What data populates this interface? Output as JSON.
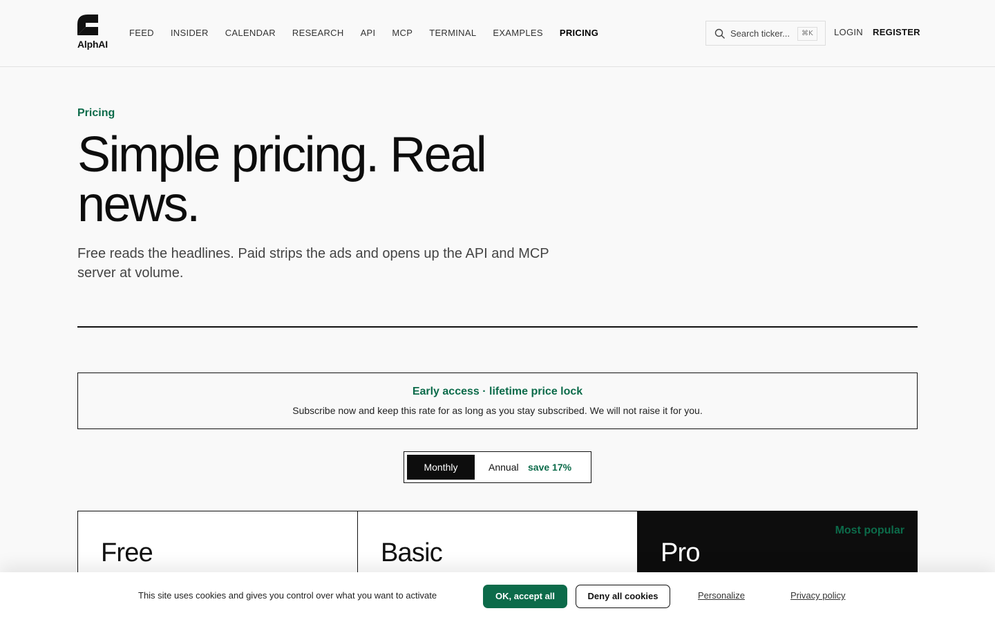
{
  "brand": {
    "name": "AlphAI",
    "logo_icon": "alphai-logo-icon"
  },
  "nav": {
    "items": [
      {
        "label": "FEED"
      },
      {
        "label": "INSIDER"
      },
      {
        "label": "CALENDAR"
      },
      {
        "label": "RESEARCH"
      },
      {
        "label": "API"
      },
      {
        "label": "MCP"
      },
      {
        "label": "TERMINAL"
      },
      {
        "label": "EXAMPLES"
      },
      {
        "label": "PRICING"
      }
    ],
    "active": "PRICING"
  },
  "search": {
    "placeholder": "Search ticker...",
    "shortcut": "⌘K",
    "icon": "search-icon"
  },
  "auth": {
    "login": "LOGIN",
    "register": "REGISTER"
  },
  "hero": {
    "eyebrow": "Pricing",
    "title": "Simple pricing. Real news.",
    "subtitle": "Free reads the headlines. Paid strips the ads and opens up the API and MCP server at volume."
  },
  "banner": {
    "title": "Early access · lifetime price lock",
    "text": "Subscribe now and keep this rate for as long as you stay subscribed. We will not raise it for you."
  },
  "billing_toggle": {
    "monthly": "Monthly",
    "annual": "Annual",
    "annual_badge": "save 17%",
    "selected": "Monthly"
  },
  "plans": [
    {
      "name": "Free",
      "badge": ""
    },
    {
      "name": "Basic",
      "badge": ""
    },
    {
      "name": "Pro",
      "badge": "Most popular"
    }
  ],
  "cookie": {
    "text": "This site uses cookies and gives you control over what you want to activate",
    "accept": "OK, accept all",
    "deny": "Deny all cookies",
    "personalize": "Personalize",
    "privacy": "Privacy policy"
  },
  "colors": {
    "accent_green": "#0c6b4a",
    "background": "#f9f9f9",
    "dark": "#0d0d0d"
  }
}
